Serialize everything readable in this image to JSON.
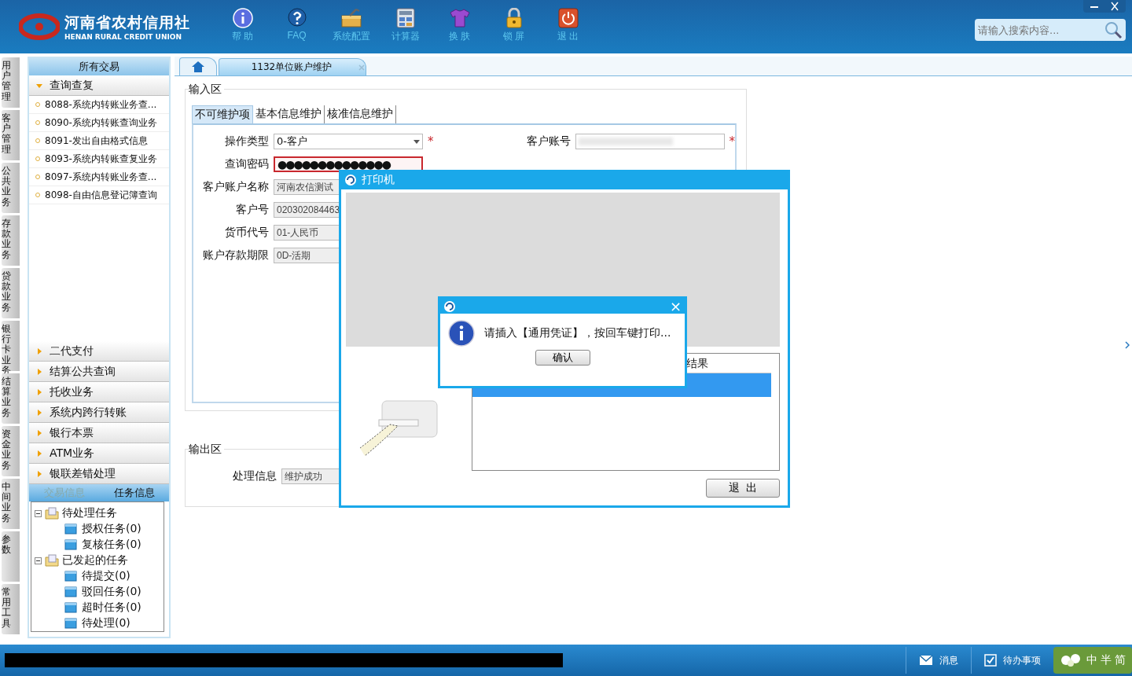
{
  "header": {
    "logo_cn": "河南省农村信用社",
    "logo_en": "HENAN RURAL CREDIT UNION",
    "toolbar": [
      {
        "label": "帮 助",
        "kind": "info"
      },
      {
        "label": "FAQ",
        "kind": "faq"
      },
      {
        "label": "系统配置",
        "kind": "config"
      },
      {
        "label": "计算器",
        "kind": "calc"
      },
      {
        "label": "换 肤",
        "kind": "skin"
      },
      {
        "label": "锁 屏",
        "kind": "lock"
      },
      {
        "label": "退 出",
        "kind": "exit"
      }
    ],
    "search": {
      "placeholder": "请输入搜索内容..."
    }
  },
  "side_tabs": [
    "用户管理",
    "客户管理",
    "公共业务",
    "存款业务",
    "贷款业务",
    "银行卡业务",
    "结算业务",
    "资金业务",
    "中间业务",
    "参数",
    "常用工具"
  ],
  "sidebar": {
    "title": "所有交易",
    "groups": [
      {
        "label": "查询查复",
        "expanded": true,
        "items": [
          "8088-系统内转账业务查...",
          "8090-系统内转账查询业务",
          "8091-发出自由格式信息",
          "8093-系统内转账查复业务",
          "8097-系统内转账业务查...",
          "8098-自由信息登记簿查询"
        ]
      },
      {
        "label": "二代支付",
        "expanded": false
      },
      {
        "label": "结算公共查询",
        "expanded": false
      },
      {
        "label": "托收业务",
        "expanded": false
      },
      {
        "label": "系统内跨行转账",
        "expanded": false
      },
      {
        "label": "银行本票",
        "expanded": false
      },
      {
        "label": "ATM业务",
        "expanded": false
      },
      {
        "label": "银联差错处理",
        "expanded": false
      }
    ]
  },
  "task_panel": {
    "tabs": [
      {
        "label": "交易信息",
        "selected": false
      },
      {
        "label": "任务信息",
        "selected": true
      }
    ],
    "tree": [
      {
        "label": "待处理任务",
        "expanded": true,
        "children": [
          {
            "label": "授权任务(0)"
          },
          {
            "label": "复核任务(0)"
          }
        ]
      },
      {
        "label": "已发起的任务",
        "expanded": true,
        "children": [
          {
            "label": "待提交(0)"
          },
          {
            "label": "驳回任务(0)"
          },
          {
            "label": "超时任务(0)"
          },
          {
            "label": "待处理(0)"
          }
        ]
      }
    ]
  },
  "content_tabs": [
    {
      "kind": "home",
      "selected": false
    },
    {
      "kind": "page",
      "label": "1132单位账户维护",
      "selected": true
    }
  ],
  "input_area": {
    "title": "输入区",
    "tabs": [
      {
        "label": "不可维护项",
        "selected": true
      },
      {
        "label": "基本信息维护",
        "selected": false
      },
      {
        "label": "核准信息维护",
        "selected": false
      }
    ],
    "left_fields": [
      {
        "label": "操作类型",
        "kind": "select",
        "value": "0-客户",
        "disabled": false,
        "invalid": false,
        "required_mark": "*"
      },
      {
        "label": "查询密码",
        "kind": "password",
        "value": "●●●●●●●●●●●●●●",
        "disabled": false,
        "invalid": true
      },
      {
        "label": "客户账户名称",
        "kind": "text",
        "value": "河南农信测试",
        "disabled": true,
        "invalid": false
      },
      {
        "label": "客户号",
        "kind": "text",
        "value": "020302084463",
        "disabled": true,
        "invalid": false
      },
      {
        "label": "货币代号",
        "kind": "text",
        "value": "01-人民币",
        "disabled": true,
        "invalid": false
      },
      {
        "label": "账户存款期限",
        "kind": "text",
        "value": "0D-活期",
        "disabled": true,
        "invalid": false
      }
    ],
    "right_fields": [
      {
        "label": "客户账号",
        "kind": "redacted",
        "disabled": false,
        "invalid": false,
        "required_mark": "*"
      }
    ]
  },
  "output_area": {
    "title": "输出区",
    "fields": [
      {
        "label": "处理信息",
        "value": "维护成功"
      }
    ]
  },
  "printer_dialog": {
    "title": "打印机",
    "table": {
      "header": "结果",
      "rows": [
        {
          "selected": true
        }
      ]
    },
    "exit_button": "退  出"
  },
  "message_box": {
    "close": "×",
    "message": "请插入【通用凭证】，按回车键打印...",
    "ok_button": "确认"
  },
  "status_bar": {
    "items": [
      {
        "label": "消息",
        "kind": "message"
      },
      {
        "label": "待办事项",
        "kind": "todo"
      }
    ],
    "ime": [
      "中",
      "半",
      "简"
    ]
  }
}
